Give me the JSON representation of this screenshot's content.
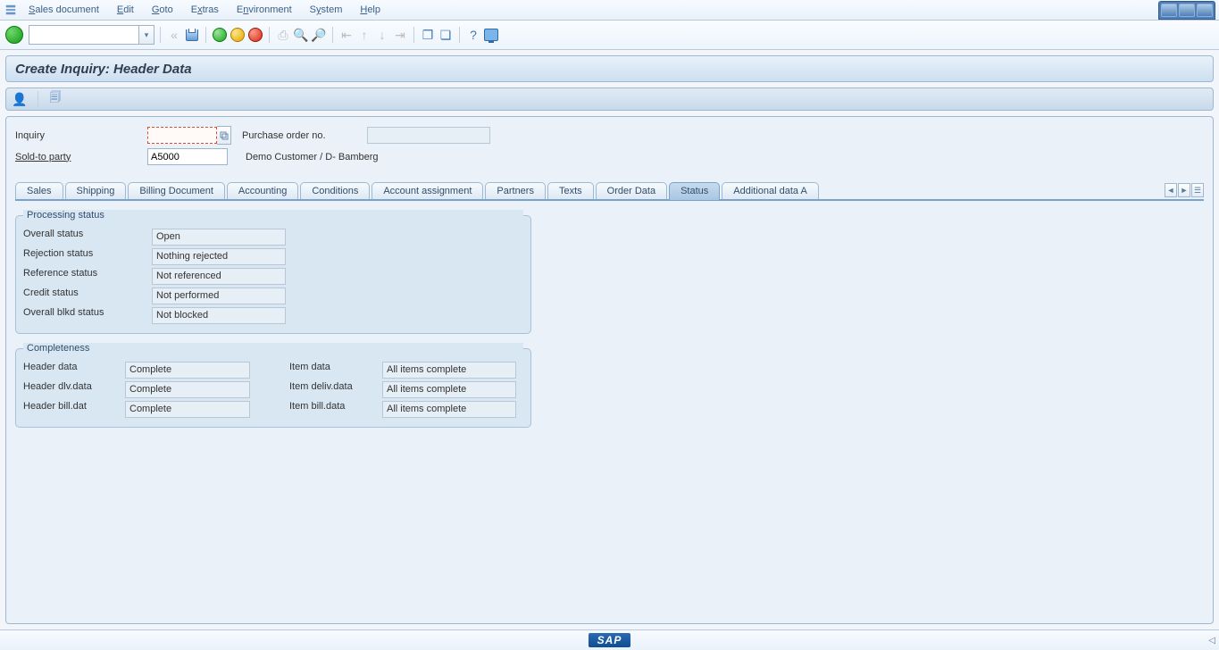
{
  "menu": {
    "items": [
      "Sales document",
      "Edit",
      "Goto",
      "Extras",
      "Environment",
      "System",
      "Help"
    ]
  },
  "page_title": "Create Inquiry: Header Data",
  "header": {
    "inquiry_label": "Inquiry",
    "inquiry_value": "",
    "po_label": "Purchase order no.",
    "po_value": "",
    "soldto_label": "Sold-to party",
    "soldto_value": "A5000",
    "soldto_desc": "Demo Customer / D- Bamberg"
  },
  "tabs": [
    "Sales",
    "Shipping",
    "Billing Document",
    "Accounting",
    "Conditions",
    "Account assignment",
    "Partners",
    "Texts",
    "Order Data",
    "Status",
    "Additional data A"
  ],
  "active_tab": "Status",
  "processing": {
    "legend": "Processing status",
    "rows": [
      {
        "label": "Overall status",
        "value": "Open"
      },
      {
        "label": "Rejection status",
        "value": "Nothing rejected"
      },
      {
        "label": "Reference status",
        "value": "Not referenced"
      },
      {
        "label": "Credit status",
        "value": "Not performed"
      },
      {
        "label": "Overall blkd status",
        "value": "Not blocked"
      }
    ]
  },
  "completeness": {
    "legend": "Completeness",
    "rows": [
      {
        "l1": "Header data",
        "v1": "Complete",
        "l2": "Item data",
        "v2": "All items complete"
      },
      {
        "l1": "Header dlv.data",
        "v1": "Complete",
        "l2": "Item deliv.data",
        "v2": "All items complete"
      },
      {
        "l1": "Header bill.dat",
        "v1": "Complete",
        "l2": "Item bill.data",
        "v2": "All items complete"
      }
    ]
  }
}
